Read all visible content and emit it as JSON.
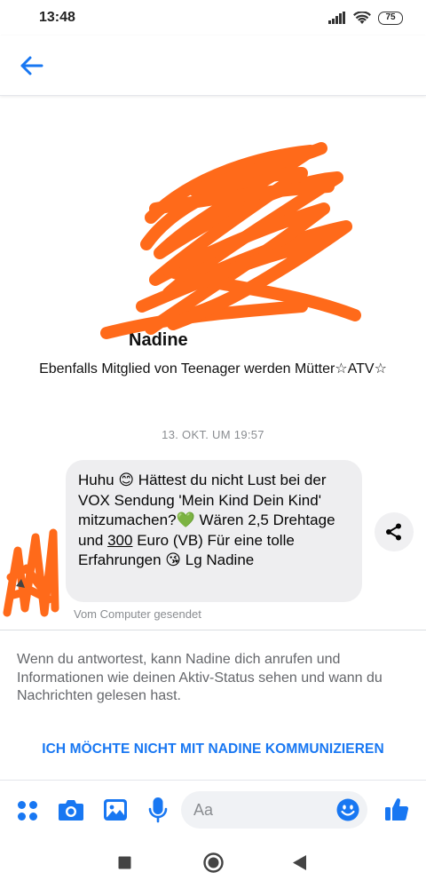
{
  "status_bar": {
    "time": "13:48",
    "battery": "75",
    "icons": [
      "signal-icon",
      "wifi-icon",
      "battery-icon"
    ]
  },
  "header": {
    "back_icon": "arrow-left-icon"
  },
  "profile": {
    "name": "Nadine",
    "group_line": "Ebenfalls Mitglied von Teenager werden Mütter☆ATV☆"
  },
  "conversation": {
    "date_divider": "13. OKT. UM 19:57",
    "message": {
      "part1": "Huhu 😊 Hättest du nicht Lust bei der VOX Sendung 'Mein Kind Dein Kind' mitzumachen?💚 Wären 2,5 Drehtage und ",
      "amount": "300",
      "part2": " Euro (VB) Für eine tolle Erfahrungen 😘 Lg Nadine",
      "sent_from": "Vom Computer gesendet"
    }
  },
  "notice": {
    "text": "Wenn du antwortest, kann Nadine dich anrufen und Informationen wie deinen Aktiv-Status sehen und wann du Nachrichten gelesen hast.",
    "block_link": "ICH MÖCHTE NICHT MIT NADINE KOMMUNIZIEREN"
  },
  "composer": {
    "placeholder": "Aa",
    "icons": [
      "apps-icon",
      "camera-icon",
      "gallery-icon",
      "microphone-icon",
      "emoji-icon",
      "thumbs-up-icon"
    ]
  },
  "colors": {
    "accent": "#1877f2",
    "scribble": "#ff6a1a",
    "bubble": "#eeeef0"
  }
}
